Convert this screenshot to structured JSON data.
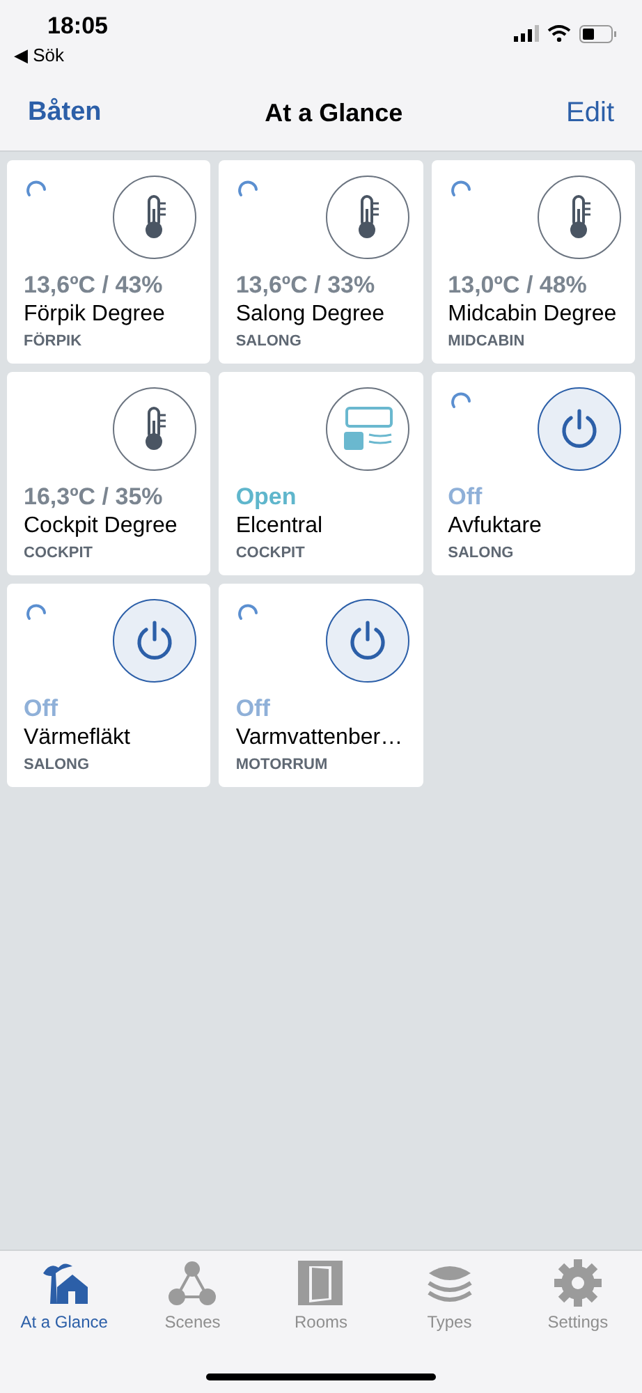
{
  "status_bar": {
    "time": "18:05",
    "back_link": "◀ Sök"
  },
  "nav_bar": {
    "back": "Båten",
    "title": "At a Glance",
    "action": "Edit"
  },
  "tiles": [
    {
      "kind": "thermometer",
      "loading": true,
      "value": "13,6ºC / 43%",
      "name": "Förpik Degree",
      "room": "FÖRPIK"
    },
    {
      "kind": "thermometer",
      "loading": true,
      "value": "13,6ºC / 33%",
      "name": "Salong Degree",
      "room": "SALONG"
    },
    {
      "kind": "thermometer",
      "loading": true,
      "value": "13,0ºC / 48%",
      "name": "Midcabin Degree",
      "room": "MIDCABIN"
    },
    {
      "kind": "thermometer",
      "loading": false,
      "value": "16,3ºC / 35%",
      "name": "Cockpit Degree",
      "room": "COCKPIT"
    },
    {
      "kind": "panel",
      "loading": false,
      "value": "Open",
      "name": "Elcentral",
      "room": "COCKPIT"
    },
    {
      "kind": "power",
      "loading": true,
      "value": "Off",
      "name": "Avfuktare",
      "room": "SALONG"
    },
    {
      "kind": "power",
      "loading": true,
      "value": "Off",
      "name": "Värmefläkt",
      "room": "SALONG"
    },
    {
      "kind": "power",
      "loading": true,
      "value": "Off",
      "name": "Varmvattenber…",
      "room": "MOTORRUM"
    }
  ],
  "tab_bar": [
    {
      "kind": "glance",
      "label": "At a Glance",
      "selected": true
    },
    {
      "kind": "scenes",
      "label": "Scenes",
      "selected": false
    },
    {
      "kind": "rooms",
      "label": "Rooms",
      "selected": false
    },
    {
      "kind": "types",
      "label": "Types",
      "selected": false
    },
    {
      "kind": "settings",
      "label": "Settings",
      "selected": false
    }
  ]
}
